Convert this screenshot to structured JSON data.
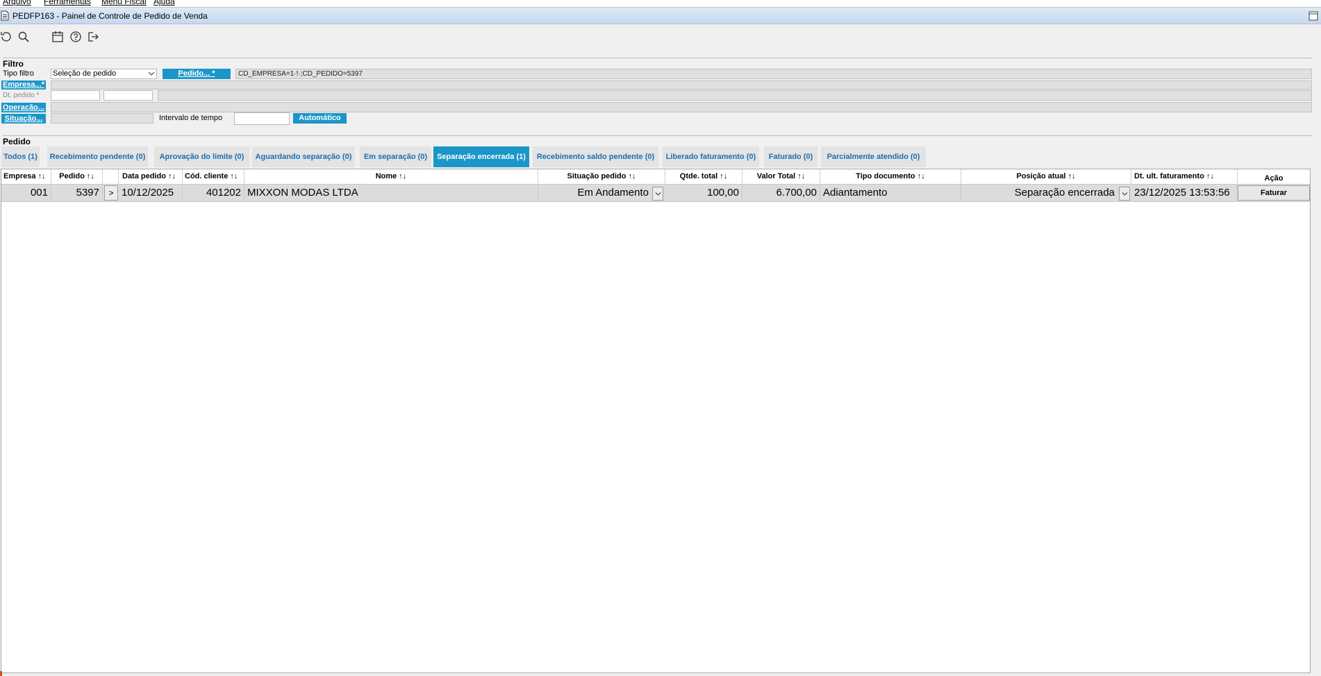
{
  "menu": [
    "Arquivo",
    "Ferramentas",
    "Menu Fiscal",
    "Ajuda"
  ],
  "window": {
    "title": "PEDFP163 - Painel de Controle de Pedido de Venda"
  },
  "toolbar": {
    "icons": [
      "refresh-icon",
      "search-icon",
      "calendar-icon",
      "help-icon",
      "exit-icon"
    ]
  },
  "filtro": {
    "section_title": "Filtro",
    "tipo_filtro_label": "Tipo filtro",
    "tipo_filtro_value": "Seleção de pedido",
    "pedido_button": "Pedido... *",
    "pedido_value": "CD_EMPRESA=1·!·;CD_PEDIDO=5397",
    "empresa_button": "Empresa...*",
    "dt_pedido_label": "Dt. pedido *",
    "operacao_button": "Operação...",
    "situacao_button": "Situação...",
    "intervalo_label": "Intervalo de tempo",
    "automatico_button": "Automático"
  },
  "pedido": {
    "section_title": "Pedido",
    "tabs": [
      "Todos (1)",
      "Recebimento pendente (0)",
      "Aprovação do limite (0)",
      "Aguardando separação (0)",
      "Em separação (0)",
      "Separação encerrada (1)",
      "Recebimento saldo pendente (0)",
      "Liberado faturamento (0)",
      "Faturado (0)",
      "Parcialmente atendido (0)"
    ],
    "active_tab": 5
  },
  "grid": {
    "columns": [
      "Empresa ↑↓",
      "Pedido ↑↓",
      "",
      "Data pedido ↑↓",
      "Cód. cliente ↑↓",
      "Nome ↑↓",
      "Situação pedido ↑↓",
      "Qtde. total ↑↓",
      "Valor Total ↑↓",
      "Tipo documento ↑↓",
      "Posição atual ↑↓",
      "Dt. ult. faturamento ↑↓",
      "Ação"
    ],
    "rows": [
      {
        "empresa": "001",
        "pedido": "5397",
        "expand": ">",
        "data_pedido": "10/12/2025",
        "cod_cliente": "401202",
        "nome": "MIXXON MODAS LTDA",
        "situacao": "Em Andamento",
        "qtde_total": "100,00",
        "valor_total": "6.700,00",
        "tipo_documento": "Adiantamento",
        "posicao_atual": "Separação encerrada",
        "dt_ult_faturamento": "23/12/2025 13:53:56",
        "acao": "Faturar"
      }
    ]
  },
  "colors": {
    "accent": "#1b96c8",
    "tab_text": "#1a6fb5",
    "row_bg": "#dcdcdc"
  }
}
